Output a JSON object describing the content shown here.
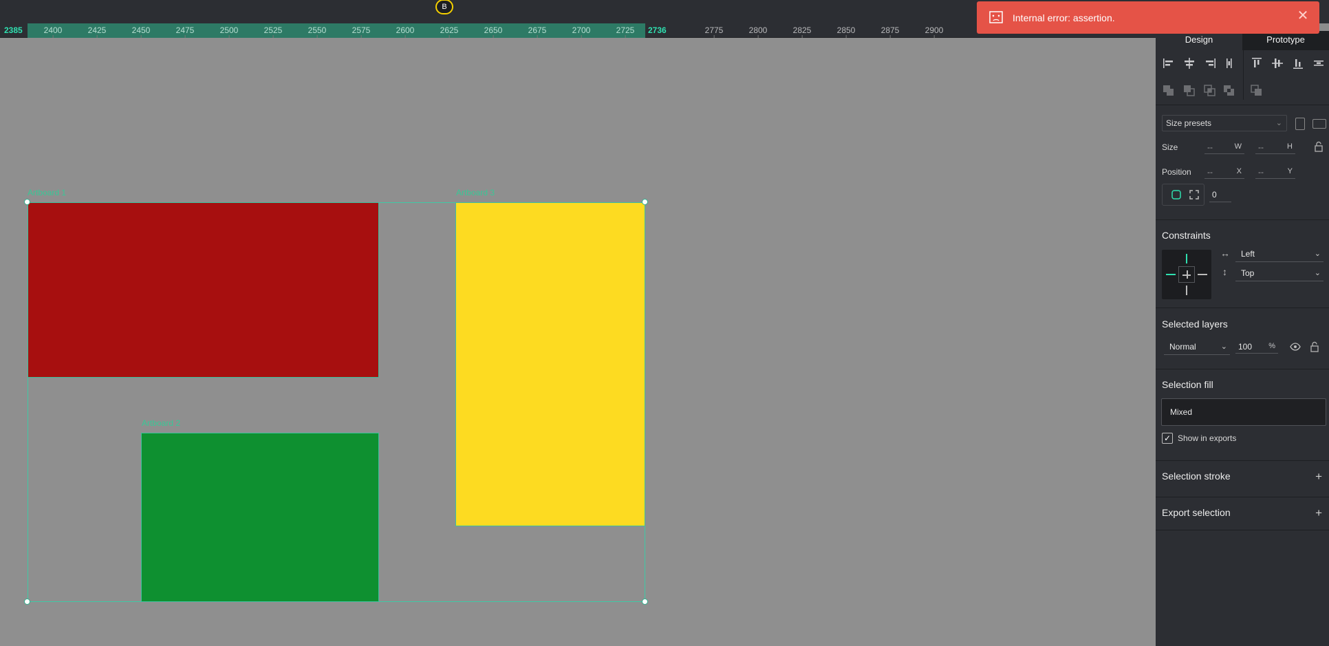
{
  "user": {
    "initial": "B"
  },
  "toast": {
    "message": "Internal error: assertion.",
    "close_icon": "close-icon",
    "icon": "broken-image-icon",
    "color": "#e55347"
  },
  "ruler": {
    "sel_start": "2385",
    "sel_end": "2736",
    "ticks": [
      "2400",
      "2425",
      "2450",
      "2475",
      "2500",
      "2525",
      "2550",
      "2575",
      "2600",
      "2625",
      "2650",
      "2675",
      "2700",
      "2725",
      "2775",
      "2800",
      "2825",
      "2850",
      "2875",
      "2900"
    ]
  },
  "canvas": {
    "background": "#8f8f8f",
    "boards": [
      {
        "label": "Artboard 1",
        "color": "#a70f0f"
      },
      {
        "label": "Artboard 3",
        "color": "#fddb21"
      },
      {
        "label": "Artboard 2",
        "color": "#0e9030"
      }
    ],
    "selection_color": "#3fc9a5"
  },
  "panel": {
    "tabs": [
      {
        "label": "Design"
      },
      {
        "label": "Prototype"
      }
    ],
    "size_presets": {
      "label": "Size presets"
    },
    "size": {
      "label": "Size",
      "w_value": "--",
      "w_axis": "W",
      "h_value": "--",
      "h_axis": "H"
    },
    "position": {
      "label": "Position",
      "x_value": "--",
      "x_axis": "X",
      "y_value": "--",
      "y_axis": "Y"
    },
    "radius": {
      "value": "0"
    },
    "constraints": {
      "title": "Constraints",
      "horizontal": "Left",
      "vertical": "Top"
    },
    "layers": {
      "title": "Selected layers",
      "blend": "Normal",
      "opacity": "100",
      "opacity_unit": "%"
    },
    "fill": {
      "title": "Selection fill",
      "value": "Mixed",
      "show_in_exports": "Show in exports"
    },
    "stroke": {
      "title": "Selection stroke"
    },
    "export": {
      "title": "Export selection"
    },
    "accent": "#2fe0b0"
  }
}
